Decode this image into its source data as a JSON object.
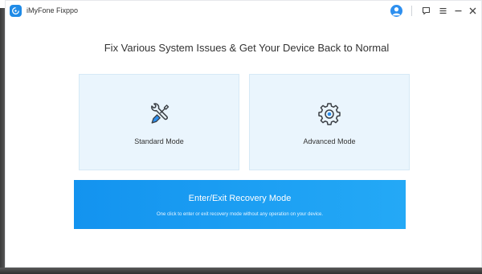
{
  "window": {
    "app_title": "iMyFone Fixppo"
  },
  "titlebar": {
    "icons": [
      "app-logo",
      "user-avatar-icon",
      "feedback-icon",
      "menu-icon",
      "minimize-icon",
      "close-icon"
    ]
  },
  "main": {
    "headline": "Fix Various System Issues & Get Your Device Back to Normal",
    "modes": [
      {
        "label": "Standard Mode",
        "icon": "wrench-screwdriver-icon"
      },
      {
        "label": "Advanced Mode",
        "icon": "gear-icon"
      }
    ],
    "recovery": {
      "title": "Enter/Exit Recovery Mode",
      "subtitle": "One click to enter or exit recovery mode without any operation on your device."
    }
  },
  "colors": {
    "accent": "#1f8be7",
    "card_bg": "#eaf5fd",
    "recovery_gradient": [
      "#1393ef",
      "#24a9f6"
    ]
  }
}
